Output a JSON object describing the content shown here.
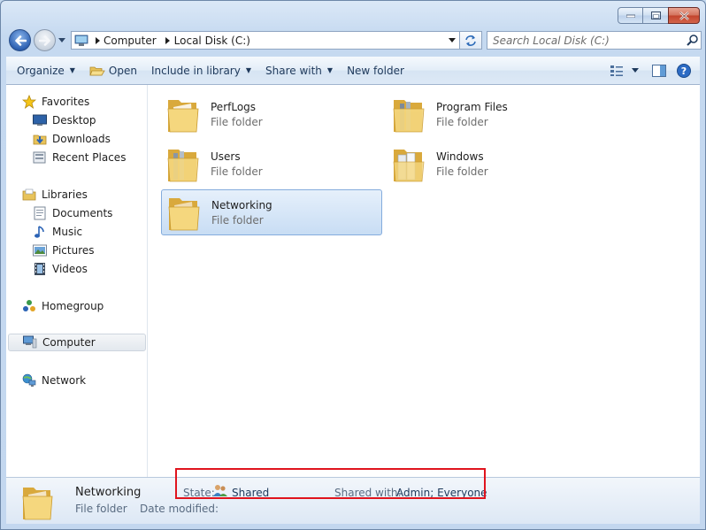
{
  "address": {
    "segments": [
      "Computer",
      "Local Disk (C:)"
    ]
  },
  "search": {
    "placeholder": "Search Local Disk (C:)"
  },
  "toolbar": {
    "organize": "Organize",
    "open": "Open",
    "include_in_library": "Include in library",
    "share_with": "Share with",
    "new_folder": "New folder"
  },
  "sidebar": {
    "favorites": {
      "label": "Favorites",
      "items": [
        "Desktop",
        "Downloads",
        "Recent Places"
      ]
    },
    "libraries": {
      "label": "Libraries",
      "items": [
        "Documents",
        "Music",
        "Pictures",
        "Videos"
      ]
    },
    "homegroup": "Homegroup",
    "computer": "Computer",
    "network": "Network"
  },
  "files": [
    {
      "name": "PerfLogs",
      "type": "File folder"
    },
    {
      "name": "Program Files",
      "type": "File folder"
    },
    {
      "name": "Users",
      "type": "File folder"
    },
    {
      "name": "Windows",
      "type": "File folder"
    },
    {
      "name": "Networking",
      "type": "File folder"
    }
  ],
  "details": {
    "name": "Networking",
    "type": "File folder",
    "date_modified_label": "Date modified:",
    "state_label": "State:",
    "state_value": "Shared",
    "shared_with_label": "Shared with:",
    "shared_with_value": "Admin; Everyone"
  },
  "colors": {
    "accent": "#1e395b",
    "highlight_box": "#e0141e",
    "selection": "#c8ddf4"
  }
}
